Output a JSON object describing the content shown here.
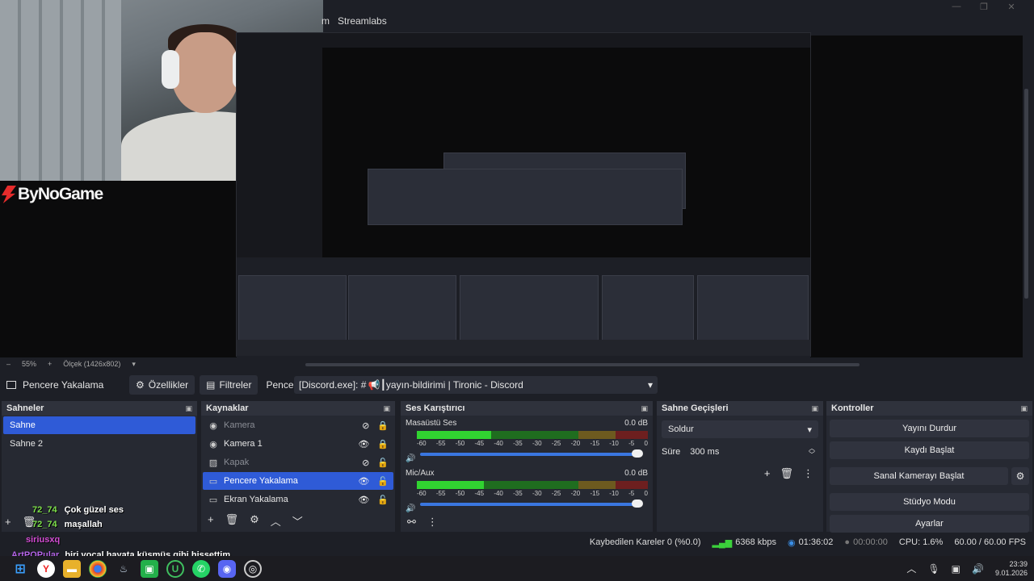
{
  "menu": {
    "partial": "m",
    "streamlabs": "Streamlabs"
  },
  "preview": {
    "logo_text": "ByNoGame",
    "nested_menu": "Streamlabs"
  },
  "scale": {
    "zoom": "55%",
    "plus": "+",
    "label": "Ölçek (1426x802)"
  },
  "source_toolbar": {
    "source_name": "Pencere Yakalama",
    "properties": "Özellikler",
    "filters": "Filtreler",
    "window_label": "Pencere",
    "window_value": "[Discord.exe]: # 📢┃yayın-bildirimi | Tironic - Discord"
  },
  "scenes": {
    "title": "Sahneler",
    "items": [
      {
        "label": "Sahne",
        "selected": true
      },
      {
        "label": "Sahne 2",
        "selected": false
      }
    ]
  },
  "sources": {
    "title": "Kaynaklar",
    "items": [
      {
        "label": "Kamera",
        "icon": "camera-icon",
        "visible": false,
        "locked": true,
        "dim": true
      },
      {
        "label": "Kamera 1",
        "icon": "camera-icon",
        "visible": true,
        "locked": true,
        "dim": false
      },
      {
        "label": "Kapak",
        "icon": "image-icon",
        "visible": false,
        "locked": false,
        "dim": true
      },
      {
        "label": "Pencere Yakalama",
        "icon": "window-icon",
        "visible": true,
        "locked": false,
        "selected": true
      },
      {
        "label": "Ekran Yakalama",
        "icon": "monitor-icon",
        "visible": true,
        "locked": false,
        "dim": false
      }
    ]
  },
  "mixer": {
    "title": "Ses Karıştırıcı",
    "channels": [
      {
        "name": "Masaüstü Ses",
        "db": "0.0 dB",
        "level": 0.32
      },
      {
        "name": "Mic/Aux",
        "db": "0.0 dB",
        "level": 0.29
      }
    ],
    "ticks": [
      "-60",
      "-55",
      "-50",
      "-45",
      "-40",
      "-35",
      "-30",
      "-25",
      "-20",
      "-15",
      "-10",
      "-5",
      "0"
    ]
  },
  "transitions": {
    "title": "Sahne Geçişleri",
    "type": "Soldur",
    "duration_label": "Süre",
    "duration_value": "300 ms"
  },
  "controls": {
    "title": "Kontroller",
    "stop_stream": "Yayını Durdur",
    "start_recording": "Kaydı Başlat",
    "virtual_camera": "Sanal Kamerayı Başlat",
    "studio_mode": "Stüdyo Modu",
    "settings": "Ayarlar"
  },
  "status": {
    "dropped_frames": "Kaybedilen Kareler 0 (%0.0)",
    "bitrate": "6368 kbps",
    "stream_time": "01:36:02",
    "rec_time": "00:00:00",
    "cpu": "CPU: 1.6%",
    "fps": "60.00 / 60.00 FPS"
  },
  "chat": [
    {
      "user": "72_74",
      "message": "Çok güzel ses",
      "user_color": "#7ee04b"
    },
    {
      "user": "72_74",
      "message": "maşallah",
      "user_color": "#7ee04b"
    },
    {
      "user": "siriusxq",
      "message": "",
      "user_color": "#d44dd4"
    },
    {
      "user": "ArtPOPular",
      "message": "biri vocal hayata küsmüş gibi hissettim",
      "user_color": "#b565e8"
    }
  ],
  "taskbar": {
    "time": "23:39",
    "date": "9.01.2026"
  }
}
